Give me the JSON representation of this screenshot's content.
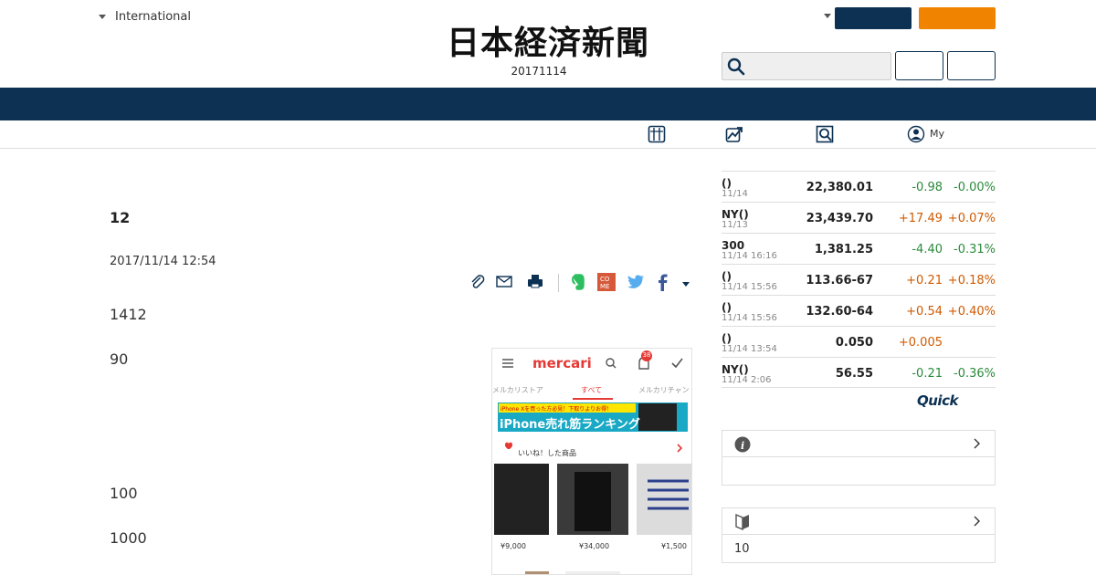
{
  "header": {
    "edition_label": "International",
    "logo_text": "日本経済新聞",
    "date": "20171114"
  },
  "subnav": {
    "my_label": "My"
  },
  "article": {
    "title": "12",
    "datetime": "2017/11/14 12:54",
    "paragraphs": [
      "1412",
      "90",
      "100",
      "1000"
    ]
  },
  "image": {
    "app_name": "mercari",
    "notif_count": "38",
    "tabs": [
      "メルカリストア",
      "すべて",
      "メルカリチャン"
    ],
    "banner_line1": "iPhone Xを買った方必見！下取りよりお得！",
    "banner_line2": "iPhone売れ筋ランキング",
    "liked_label": "いいね！した商品",
    "prices": [
      "¥9,000",
      "¥34,000",
      "¥1,500"
    ]
  },
  "market": {
    "rows": [
      {
        "name": "()",
        "time": "11/14",
        "value": "22,380.01",
        "change": "-0.98",
        "pct": "-0.00%",
        "dir": "down"
      },
      {
        "name": "NY()",
        "time": "11/13",
        "value": "23,439.70",
        "change": "+17.49",
        "pct": "+0.07%",
        "dir": "up"
      },
      {
        "name": "300",
        "time": "11/14 16:16",
        "value": "1,381.25",
        "change": "-4.40",
        "pct": "-0.31%",
        "dir": "down"
      },
      {
        "name": "()",
        "time": "11/14 15:56",
        "value": "113.66-67",
        "change": "+0.21",
        "pct": "+0.18%",
        "dir": "up"
      },
      {
        "name": "()",
        "time": "11/14 15:56",
        "value": "132.60-64",
        "change": "+0.54",
        "pct": "+0.40%",
        "dir": "up"
      },
      {
        "name": "()",
        "time": "11/14 13:54",
        "value": "0.050",
        "change": "+0.005",
        "pct": "",
        "dir": "up"
      },
      {
        "name": "NY()",
        "time": "11/14 2:06",
        "value": "56.55",
        "change": "-0.21",
        "pct": "-0.36%",
        "dir": "down"
      }
    ],
    "quick_label": "Quick"
  },
  "sidebox2": {
    "text": "10"
  },
  "colors": {
    "navy": "#0c3152",
    "orange": "#f08300",
    "up": "#d05a00",
    "down": "#2a8a3a"
  }
}
